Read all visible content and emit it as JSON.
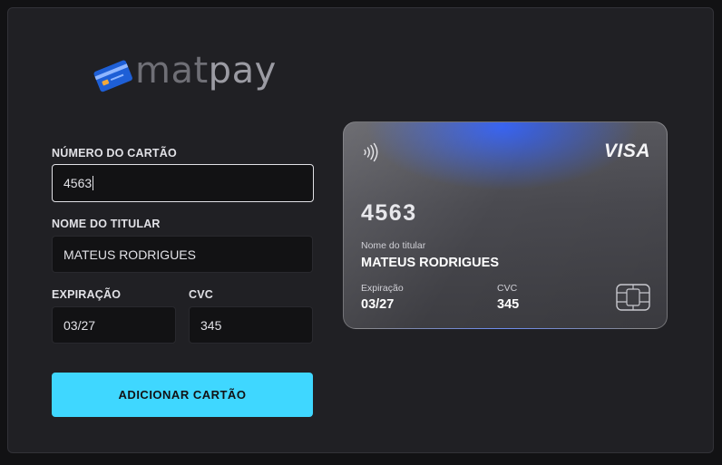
{
  "logo": {
    "text_part1": "mat",
    "text_part2": "pay",
    "icon": "credit-card-icon"
  },
  "form": {
    "card_number_label": "NÚMERO DO CARTÃO",
    "card_number_value": "4563",
    "holder_label": "NOME DO TITULAR",
    "holder_value": "MATEUS RODRIGUES",
    "expiry_label": "EXPIRAÇÃO",
    "expiry_value": "03/27",
    "cvc_label": "CVC",
    "cvc_value": "345",
    "submit_label": "ADICIONAR CARTÃO"
  },
  "card": {
    "brand": "VISA",
    "number": "4563",
    "holder_label": "Nome do titular",
    "holder": "MATEUS RODRIGUES",
    "expiry_label": "Expiração",
    "expiry": "03/27",
    "cvc_label": "CVC",
    "cvc": "345",
    "icons": [
      "contactless-icon",
      "chip-icon"
    ]
  },
  "colors": {
    "background": "#121214",
    "panel": "#202024",
    "accent": "#3fd7ff",
    "card_glow": "#3460f0"
  }
}
